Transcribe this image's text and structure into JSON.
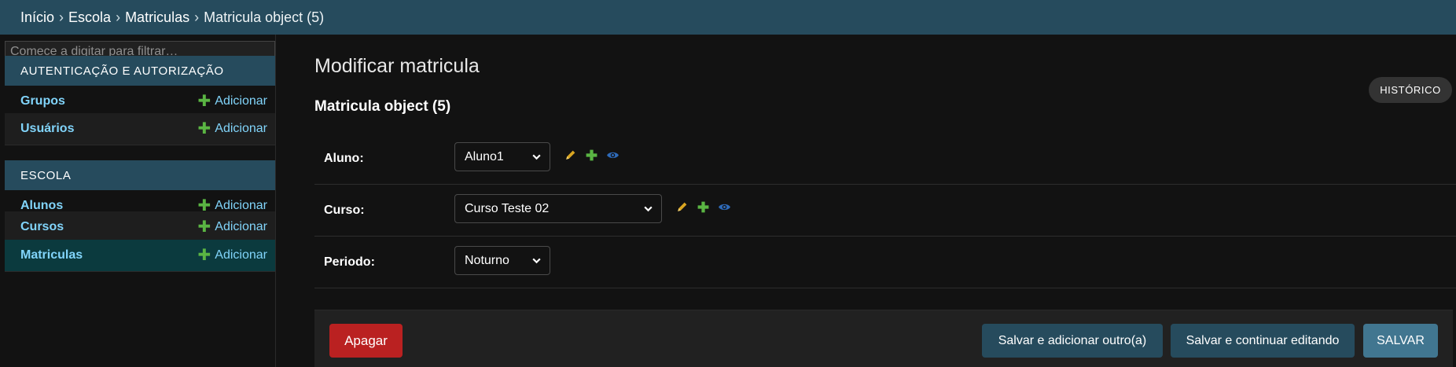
{
  "breadcrumbs": {
    "home": "Início",
    "app": "Escola",
    "model": "Matriculas",
    "current": "Matricula object (5)",
    "separator": "›"
  },
  "sidebar": {
    "filter_placeholder": "Comece a digitar para filtrar…",
    "modules": [
      {
        "caption": "AUTENTICAÇÃO E AUTORIZAÇÃO",
        "models": [
          {
            "name": "Grupos",
            "add": "Adicionar"
          },
          {
            "name": "Usuários",
            "add": "Adicionar"
          }
        ]
      },
      {
        "caption": "ESCOLA",
        "models": [
          {
            "name": "Alunos",
            "add": "Adicionar"
          },
          {
            "name": "Cursos",
            "add": "Adicionar"
          },
          {
            "name": "Matriculas",
            "add": "Adicionar"
          }
        ]
      }
    ],
    "selected_model": "Matriculas"
  },
  "main": {
    "title": "Modificar matricula",
    "history_label": "HISTÓRICO",
    "object_heading": "Matricula object (5)",
    "fields": [
      {
        "label": "Aluno:",
        "value": "Aluno1",
        "related_icons": [
          "pencil-icon",
          "plus-icon",
          "eye-icon"
        ]
      },
      {
        "label": "Curso:",
        "value": "Curso Teste 02",
        "related_icons": [
          "pencil-icon",
          "plus-icon",
          "eye-icon"
        ]
      },
      {
        "label": "Periodo:",
        "value": "Noturno"
      }
    ]
  },
  "actions": {
    "delete": "Apagar",
    "save_add_another": "Salvar e adicionar outro(a)",
    "save_continue": "Salvar e continuar editando",
    "save": "SALVAR"
  },
  "colors": {
    "header": "#264b5d",
    "link": "#81d4fa",
    "add_icon": "#5ab543",
    "delete": "#ba2121",
    "primary_button": "#417690",
    "selected_row": "#0b3a3e"
  }
}
